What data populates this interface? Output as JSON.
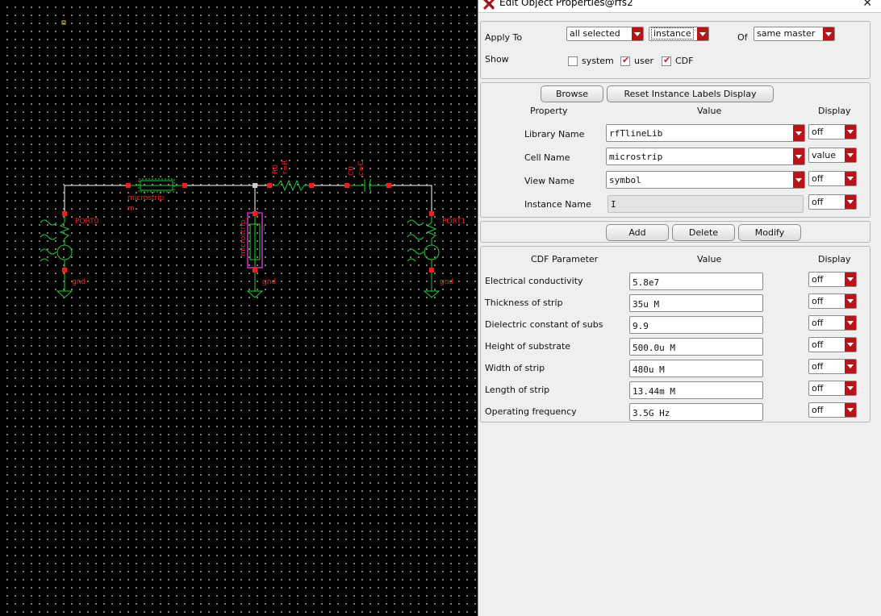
{
  "window": {
    "title": "Edit Object Properties@rfs2",
    "close_glyph": "✕",
    "app_icon": "cadence-x-icon",
    "close_icon": "close-icon"
  },
  "schematic": {
    "labels": {
      "port0": "PORT0",
      "port1": "PORT1",
      "gnd_left": "gnd",
      "gnd_mid": "gnd",
      "gnd_right": "gnd",
      "ms_h_name": "microstrip",
      "ms_h_inst": "m",
      "ms_v_name": "microstrip",
      "ms_v_inst": "I",
      "res_inst": "R0",
      "res_val": "r=R",
      "cap_inst": "C0",
      "cap_val": "c=C"
    },
    "colors": {
      "wire": "#ffffff",
      "pin": "#ff1a1a",
      "component": "#22cc33",
      "highlight": "#cc33cc",
      "text": "#ff2020"
    }
  },
  "top": {
    "apply_to_label": "Apply To",
    "apply_to_value": "all selected",
    "apply_scope_value": "instance",
    "of_label": "Of",
    "of_value": "same master",
    "show_label": "Show",
    "show_options": [
      {
        "label": "system",
        "checked": false
      },
      {
        "label": "user",
        "checked": true
      },
      {
        "label": "CDF",
        "checked": true
      }
    ]
  },
  "props": {
    "browse_label": "Browse",
    "reset_label": "Reset Instance Labels Display",
    "headers": {
      "property": "Property",
      "value": "Value",
      "display": "Display"
    },
    "rows": [
      {
        "name": "Library Name",
        "value": "rfTlineLib",
        "display": "off"
      },
      {
        "name": "Cell Name",
        "value": "microstrip",
        "display": "value"
      },
      {
        "name": "View Name",
        "value": "symbol",
        "display": "off"
      },
      {
        "name": "Instance Name",
        "value": "I",
        "display": "off"
      }
    ]
  },
  "actions": {
    "add": "Add",
    "delete": "Delete",
    "modify": "Modify"
  },
  "cdf": {
    "headers": {
      "param": "CDF Parameter",
      "value": "Value",
      "display": "Display"
    },
    "rows": [
      {
        "name": "Electrical conductivity",
        "value": "5.8e7",
        "display": "off"
      },
      {
        "name": "Thickness of strip",
        "value": "35u M",
        "display": "off"
      },
      {
        "name": "Dielectric constant of subs",
        "value": "9.9",
        "display": "off"
      },
      {
        "name": "Height of substrate",
        "value": "500.0u M",
        "display": "off"
      },
      {
        "name": "Width of strip",
        "value": "480u M",
        "display": "off"
      },
      {
        "name": "Length of  strip",
        "value": "13.44m M",
        "display": "off"
      },
      {
        "name": "Operating frequency",
        "value": "3.5G Hz",
        "display": "off"
      }
    ]
  },
  "accent": "#b8151b"
}
